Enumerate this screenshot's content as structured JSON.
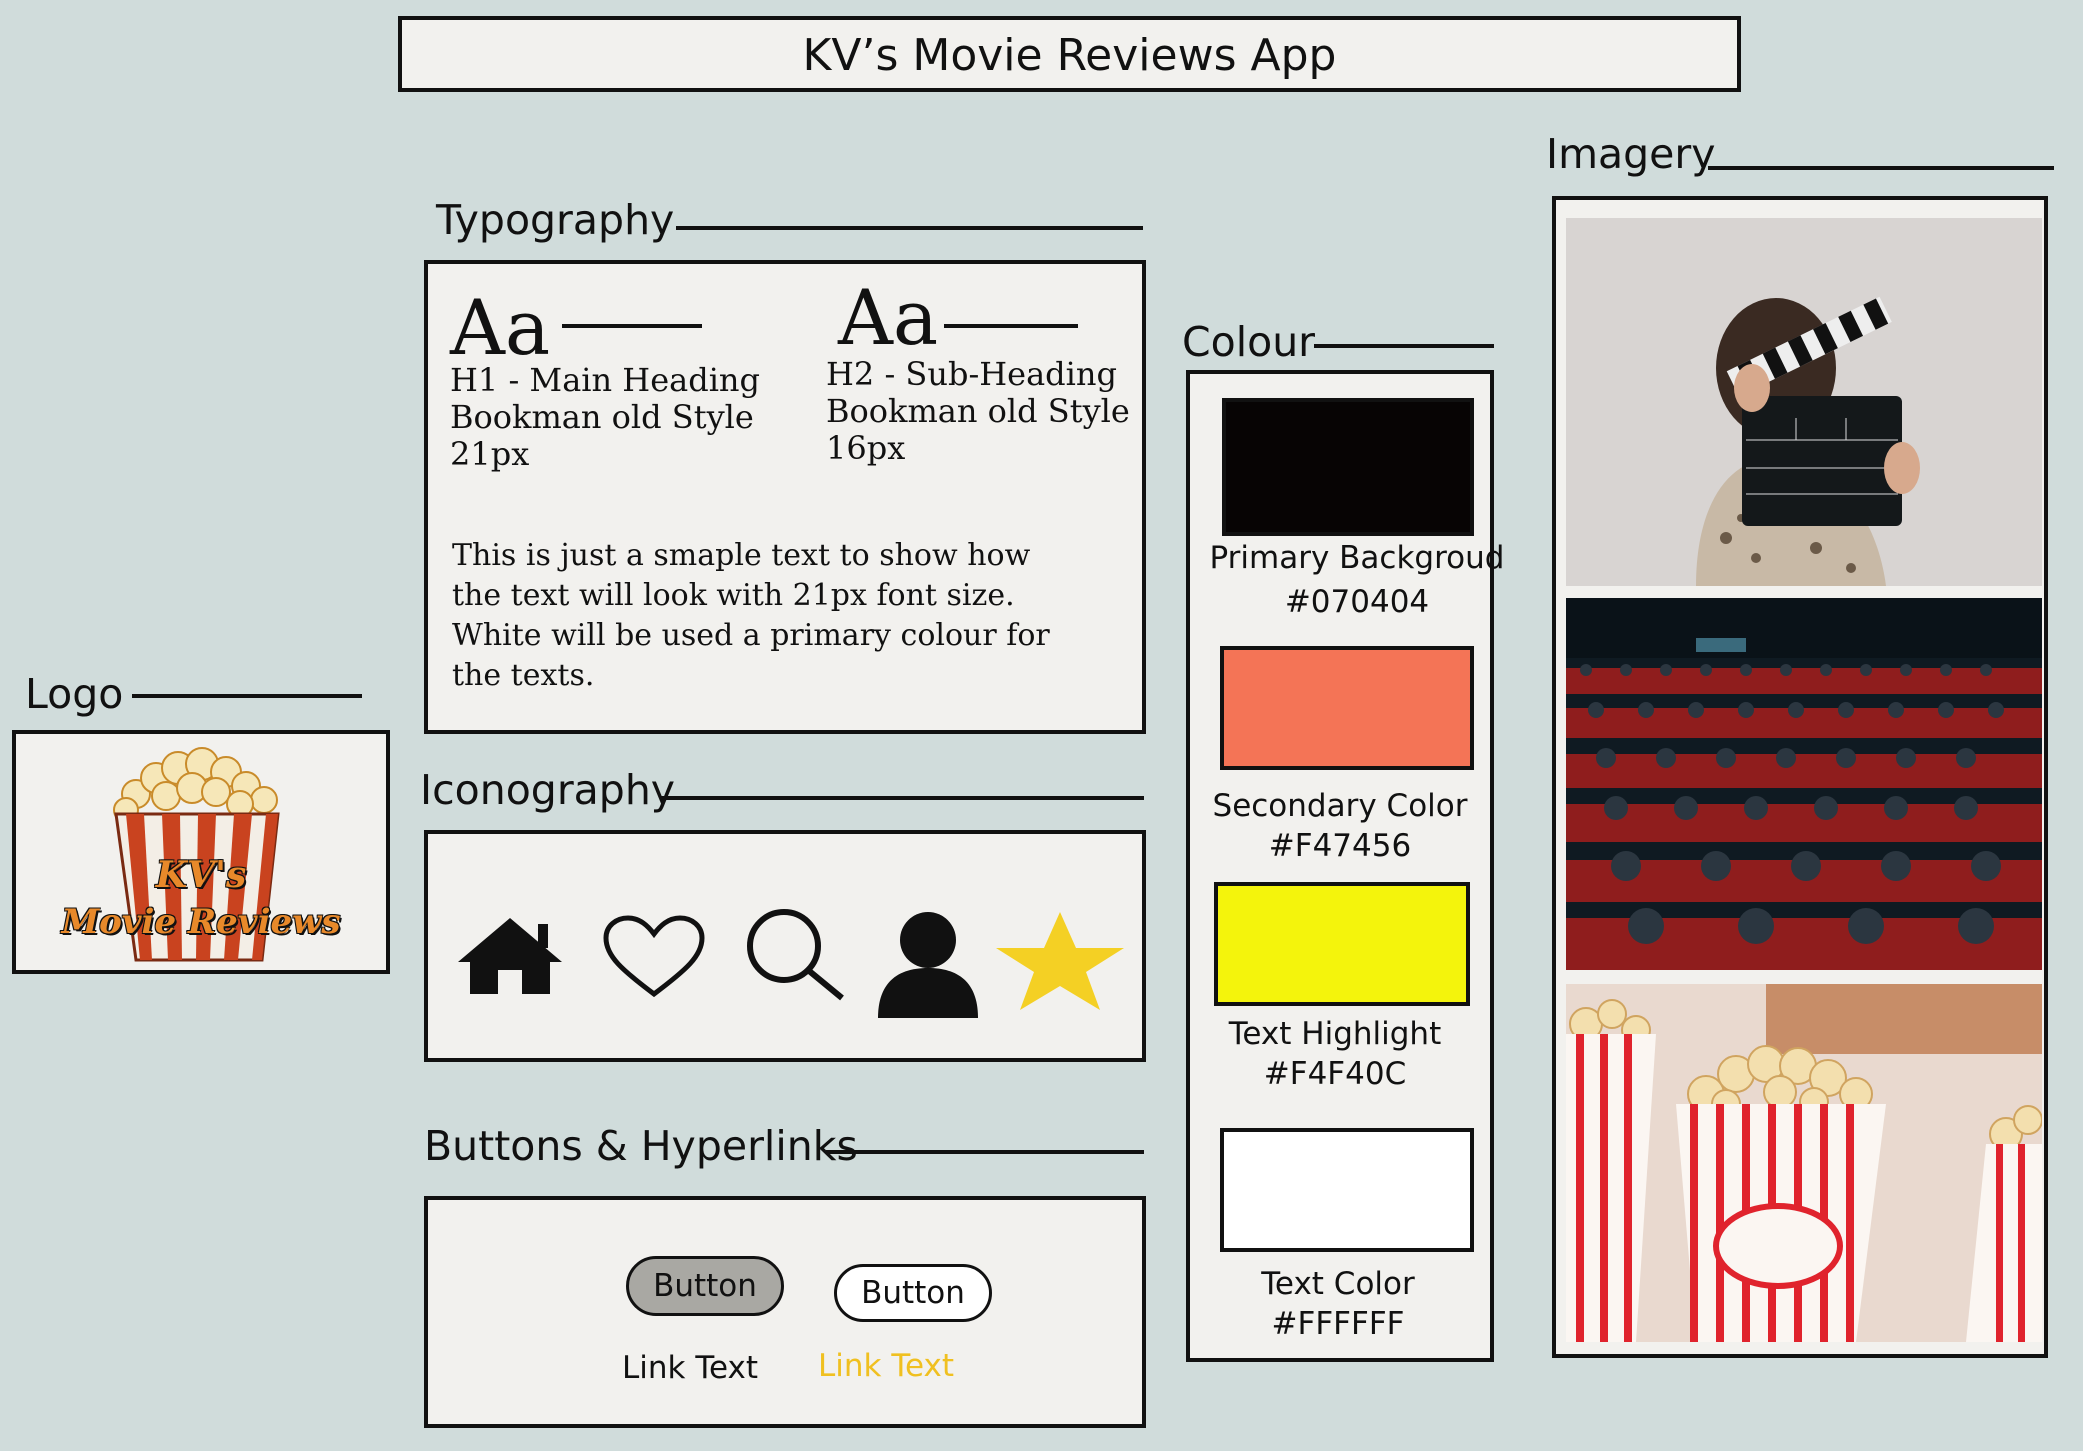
{
  "app_title": "KV’s Movie Reviews App",
  "sections": {
    "logo": "Logo",
    "typography": "Typography",
    "iconography": "Iconography",
    "buttons": "Buttons & Hyperlinks",
    "colour": "Colour",
    "imagery": "Imagery"
  },
  "logo": {
    "line1": "KV's",
    "line2": "Movie Reviews"
  },
  "typography": {
    "h1": {
      "sample": "Aa",
      "line1": "H1 - Main Heading",
      "line2": "Bookman old Style",
      "line3": "21px"
    },
    "h2": {
      "sample": "Aa",
      "line1": "H2 - Sub-Heading",
      "line2": "Bookman old Style",
      "line3": "16px"
    },
    "body_lines": [
      "This is just a smaple text to show how",
      "the text will look with 21px font size.",
      "White will be used a primary colour for",
      "the texts."
    ]
  },
  "icons": [
    "home-icon",
    "heart-icon",
    "search-icon",
    "user-icon",
    "star-icon"
  ],
  "buttons": {
    "filled_label": "Button",
    "outline_label": "Button",
    "link_label": "Link Text",
    "link_highlight_label": "Link Text",
    "filled_color": "#a9a8a3",
    "link_highlight_color": "#f0c020"
  },
  "colours": [
    {
      "name": "Primary Backgroud",
      "hex": "#070404",
      "value": "#070404"
    },
    {
      "name": "Secondary Color",
      "hex": "#F47456",
      "value": "#F47456"
    },
    {
      "name": "Text Highlight",
      "hex": "#F4F40C",
      "value": "#F4F40C"
    },
    {
      "name": "Text Color",
      "hex": "#FFFFFF",
      "value": "#FFFFFF"
    }
  ],
  "imagery": [
    "clapperboard-photo",
    "cinema-audience-photo",
    "popcorn-photo"
  ]
}
